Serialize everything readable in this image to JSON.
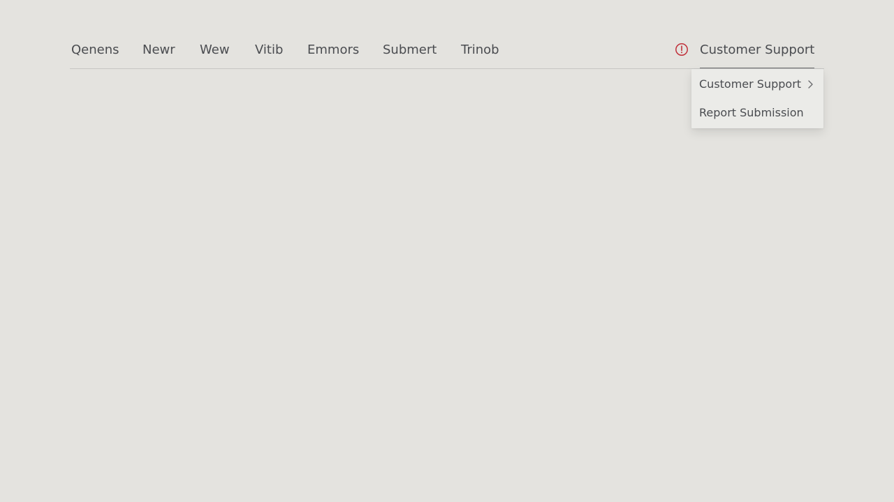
{
  "nav": {
    "items": [
      {
        "label": "Qenens"
      },
      {
        "label": "Newr"
      },
      {
        "label": "Wew"
      },
      {
        "label": "Vitib"
      },
      {
        "label": "Emmors"
      },
      {
        "label": "Submert"
      },
      {
        "label": "Trinob"
      }
    ],
    "support_label": "Customer Support",
    "alert_icon": "alert-circle-icon"
  },
  "dropdown": {
    "items": [
      {
        "label": "Customer Support",
        "has_submenu": true
      },
      {
        "label": "Report Submission",
        "has_submenu": false
      }
    ]
  },
  "colors": {
    "background": "#e4e3df",
    "text": "#4a4c50",
    "alert": "#c0303a",
    "dropdown_bg": "#ebebe8"
  }
}
